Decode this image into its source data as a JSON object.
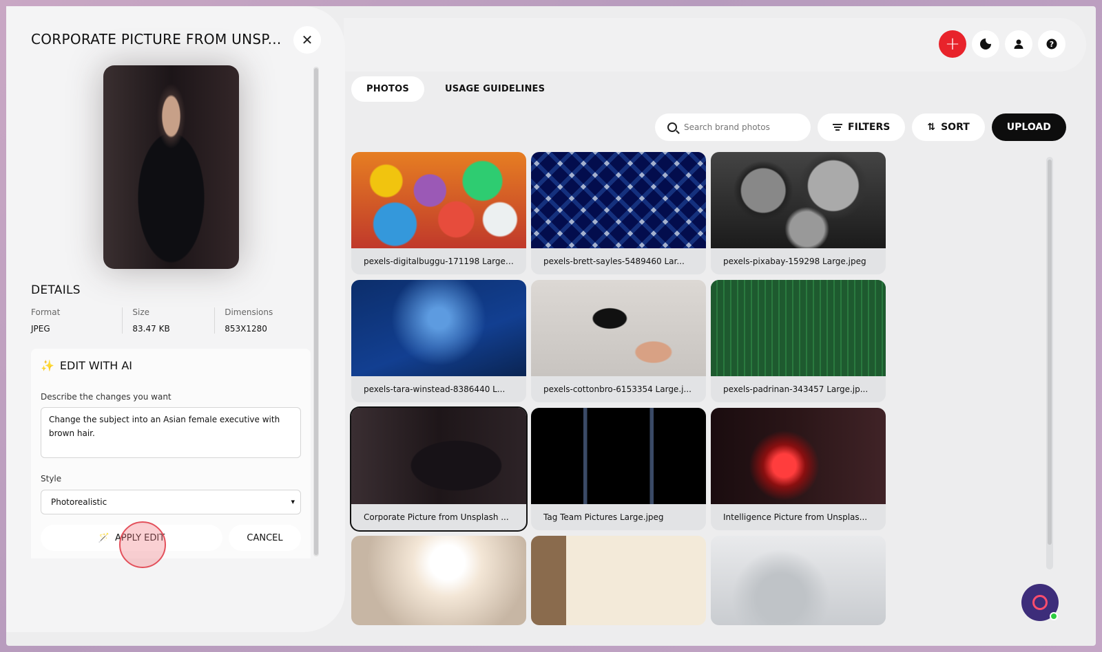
{
  "panel": {
    "title": "CORPORATE PICTURE FROM UNSP...",
    "details_heading": "DETAILS",
    "meta": [
      {
        "label": "Format",
        "value": "JPEG"
      },
      {
        "label": "Size",
        "value": "83.47 KB"
      },
      {
        "label": "Dimensions",
        "value": "853X1280"
      }
    ],
    "ai": {
      "heading": "EDIT WITH AI",
      "describe_label": "Describe the changes you want",
      "describe_value": "Change the subject into an Asian female executive with brown hair.",
      "style_label": "Style",
      "style_value": "Photorealistic",
      "apply_label": "APPLY EDIT",
      "cancel_label": "CANCEL"
    }
  },
  "tabs": [
    {
      "label": "PHOTOS",
      "active": true
    },
    {
      "label": "USAGE GUIDELINES",
      "active": false
    }
  ],
  "toolbar": {
    "search_placeholder": "Search brand photos",
    "filters_label": "FILTERS",
    "sort_label": "SORT",
    "upload_label": "UPLOAD"
  },
  "photos": [
    {
      "caption": "pexels-digitalbuggu-171198 Large...."
    },
    {
      "caption": "pexels-brett-sayles-5489460 Lar..."
    },
    {
      "caption": "pexels-pixabay-159298 Large.jpeg"
    },
    {
      "caption": "pexels-tara-winstead-8386440 L..."
    },
    {
      "caption": "pexels-cottonbro-6153354 Large.j..."
    },
    {
      "caption": "pexels-padrinan-343457 Large.jp..."
    },
    {
      "caption": "Corporate Picture from Unsplash ...",
      "selected": true
    },
    {
      "caption": "Tag Team Pictures Large.jpeg"
    },
    {
      "caption": "Intelligence Picture from Unsplas..."
    }
  ],
  "icons": {
    "add": "plus-icon",
    "theme": "moon-icon",
    "account": "user-icon",
    "help": "help-icon",
    "close": "close-icon",
    "chat": "chat-icon"
  },
  "colors": {
    "accent_red": "#e8232b",
    "ai_purple": "#9b3dd6",
    "upload_bg": "#0d0d0d"
  }
}
